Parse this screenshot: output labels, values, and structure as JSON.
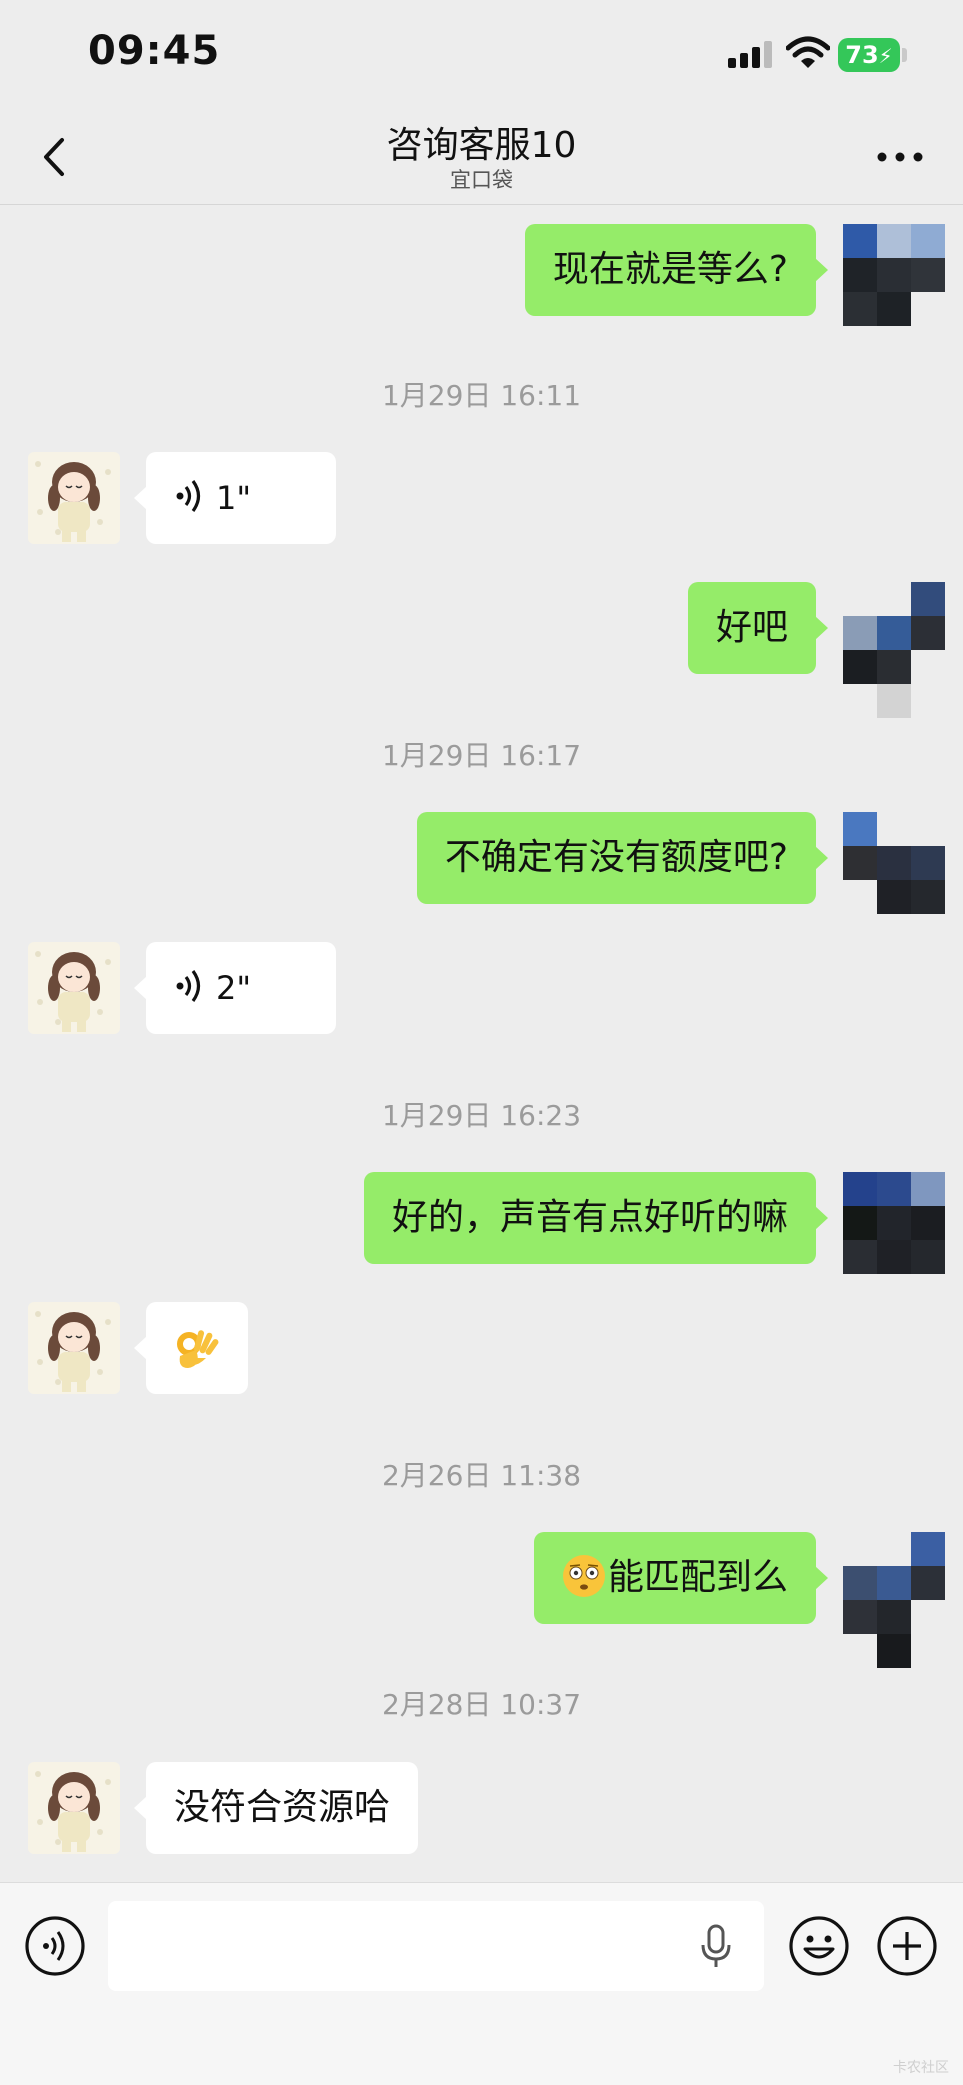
{
  "status_bar": {
    "time": "09:45",
    "battery": "73"
  },
  "nav": {
    "title": "咨询客服10",
    "subtitle": "宜口袋"
  },
  "messages": [
    {
      "type": "text",
      "side": "out",
      "text": "现在就是等么?"
    },
    {
      "type": "timestamp",
      "text": "1月29日 16:11"
    },
    {
      "type": "voice",
      "side": "in",
      "duration": "1\""
    },
    {
      "type": "text",
      "side": "out",
      "text": "好吧"
    },
    {
      "type": "timestamp",
      "text": "1月29日 16:17"
    },
    {
      "type": "text",
      "side": "out",
      "text": "不确定有没有额度吧?"
    },
    {
      "type": "voice",
      "side": "in",
      "duration": "2\""
    },
    {
      "type": "timestamp",
      "text": "1月29日 16:23"
    },
    {
      "type": "text",
      "side": "out",
      "text": "好的，声音有点好听的嘛"
    },
    {
      "type": "emoji",
      "side": "in",
      "emoji": "ok-hand-emoji"
    },
    {
      "type": "timestamp",
      "text": "2月26日 11:38"
    },
    {
      "type": "text",
      "side": "out",
      "emoji": "flushed-face-emoji",
      "text": "能匹配到么"
    },
    {
      "type": "timestamp",
      "text": "2月28日 10:37"
    },
    {
      "type": "text",
      "side": "in",
      "text": "没符合资源哈"
    }
  ],
  "input_bar": {
    "icons": [
      "voice-mode-icon",
      "microphone-icon",
      "emoji-icon",
      "plus-icon"
    ]
  },
  "colors": {
    "background": "#ededed",
    "outgoing_bubble": "#95ec69",
    "incoming_bubble": "#ffffff",
    "timestamp": "#9b9b9b",
    "battery": "#34c759"
  },
  "watermark": "卡农社区"
}
